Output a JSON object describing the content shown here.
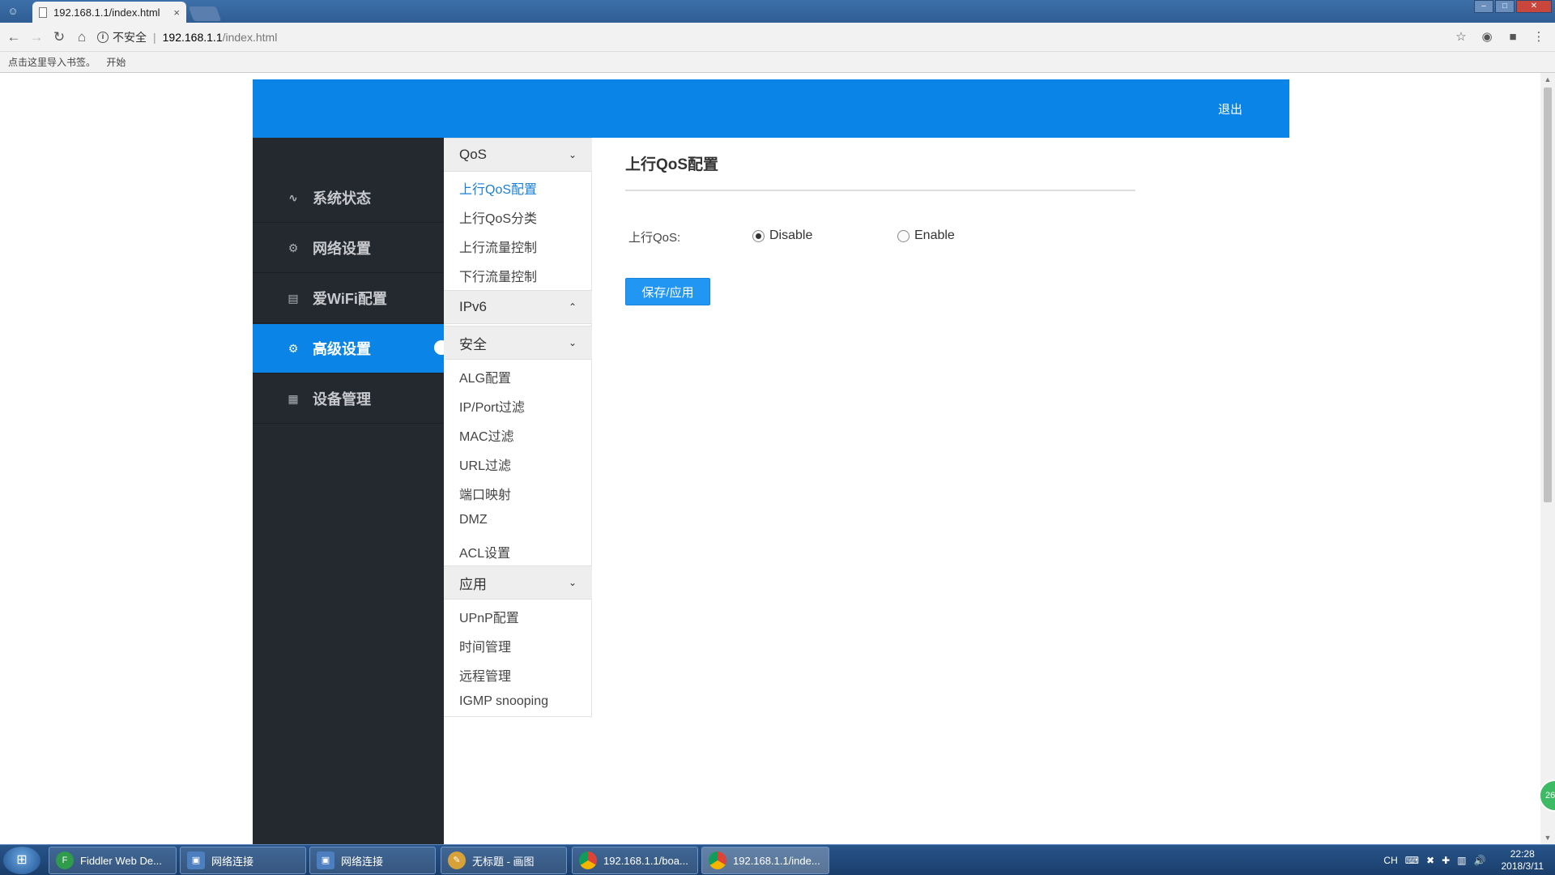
{
  "browser": {
    "tab_title": "192.168.1.1/index.html",
    "tab_close": "×",
    "security_label": "不安全",
    "url_host": "192.168.1.1",
    "url_path": "/index.html",
    "bookmarks_hint": "点击这里导入书签。",
    "bookmarks_start": "开始"
  },
  "header": {
    "logout_label": "退出"
  },
  "leftnav": {
    "items": [
      {
        "label": "系统状态",
        "icon": "pulse-icon"
      },
      {
        "label": "网络设置",
        "icon": "gear-icon"
      },
      {
        "label": "爱WiFi配置",
        "icon": "document-icon"
      },
      {
        "label": "高级设置",
        "icon": "gears-icon",
        "active": true
      },
      {
        "label": "设备管理",
        "icon": "grid-icon"
      }
    ]
  },
  "submenu": {
    "groups": [
      {
        "title": "QoS",
        "expanded": true,
        "items": [
          "上行QoS配置",
          "上行QoS分类",
          "上行流量控制",
          "下行流量控制"
        ]
      },
      {
        "title": "IPv6",
        "expanded": false,
        "items": []
      },
      {
        "title": "安全",
        "expanded": true,
        "items": [
          "ALG配置",
          "IP/Port过滤",
          "MAC过滤",
          "URL过滤",
          "端口映射",
          "DMZ",
          "ACL设置"
        ]
      },
      {
        "title": "应用",
        "expanded": true,
        "items": [
          "UPnP配置",
          "时间管理",
          "远程管理",
          "IGMP snooping"
        ]
      }
    ],
    "selected": "上行QoS配置"
  },
  "content": {
    "title": "上行QoS配置",
    "field_label": "上行QoS:",
    "options": [
      {
        "label": "Disable",
        "checked": true
      },
      {
        "label": "Enable",
        "checked": false
      }
    ],
    "save_label": "保存/应用"
  },
  "badge": {
    "text": "26"
  },
  "taskbar": {
    "items": [
      {
        "label": "Fiddler Web De...",
        "icon": "fiddler-icon"
      },
      {
        "label": "网络连接",
        "icon": "network-icon"
      },
      {
        "label": "网络连接",
        "icon": "network-icon"
      },
      {
        "label": "无标题 - 画图",
        "icon": "paint-icon"
      },
      {
        "label": "192.168.1.1/boa...",
        "icon": "chrome-icon"
      },
      {
        "label": "192.168.1.1/inde...",
        "icon": "chrome-icon",
        "active": true
      }
    ],
    "lang": "CH",
    "time": "22:28",
    "date": "2018/3/11"
  },
  "colors": {
    "accent": "#0a84e6",
    "sidebar_bg": "#24292f",
    "selected_link": "#1a7fd6"
  }
}
